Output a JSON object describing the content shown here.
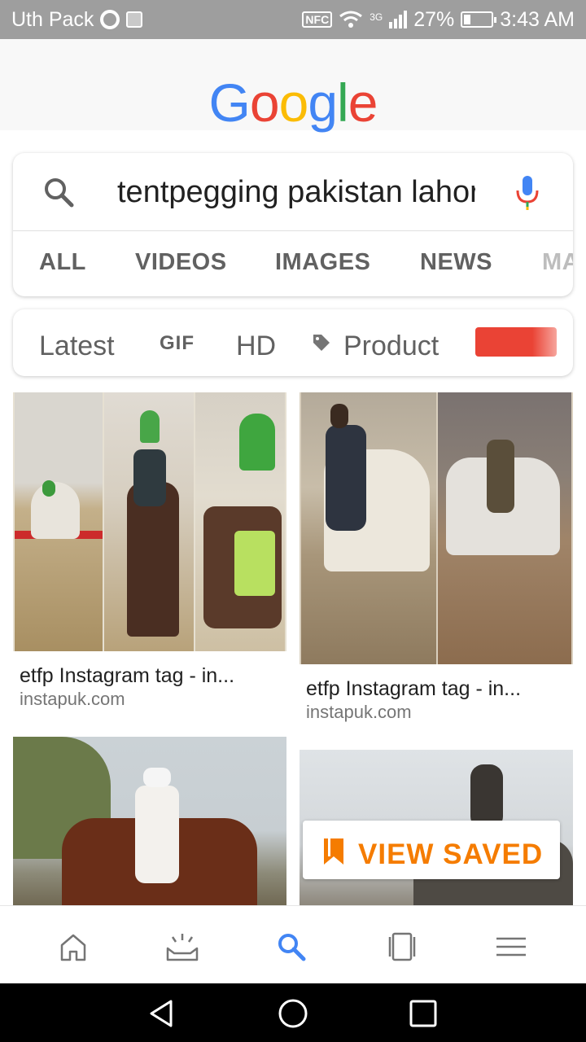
{
  "status_bar": {
    "carrier": "Uth Pack",
    "nfc": "NFC",
    "network": "3G",
    "battery": "27%",
    "time": "3:43 AM"
  },
  "logo": [
    "G",
    "o",
    "o",
    "g",
    "l",
    "e"
  ],
  "search": {
    "query": "tentpegging pakistan lahore",
    "tabs": [
      "ALL",
      "VIDEOS",
      "IMAGES",
      "NEWS",
      "MAPS"
    ]
  },
  "chips": {
    "latest": "Latest",
    "gif": "GIF",
    "hd": "HD",
    "product": "Product"
  },
  "results": [
    {
      "title": "etfp Instagram tag - in...",
      "source": "instapuk.com"
    },
    {
      "title": "etfp Instagram tag - in...",
      "source": "instapuk.com"
    }
  ],
  "view_saved": {
    "label": "VIEW SAVED"
  },
  "bottom_nav": [
    "home-icon",
    "updates-icon",
    "search-icon",
    "tabs-icon",
    "menu-icon"
  ],
  "colors": {
    "google_blue": "#4285f4",
    "google_red": "#ea4335",
    "google_yellow": "#fbbc05",
    "google_green": "#34a853",
    "accent_orange": "#f57c00"
  }
}
